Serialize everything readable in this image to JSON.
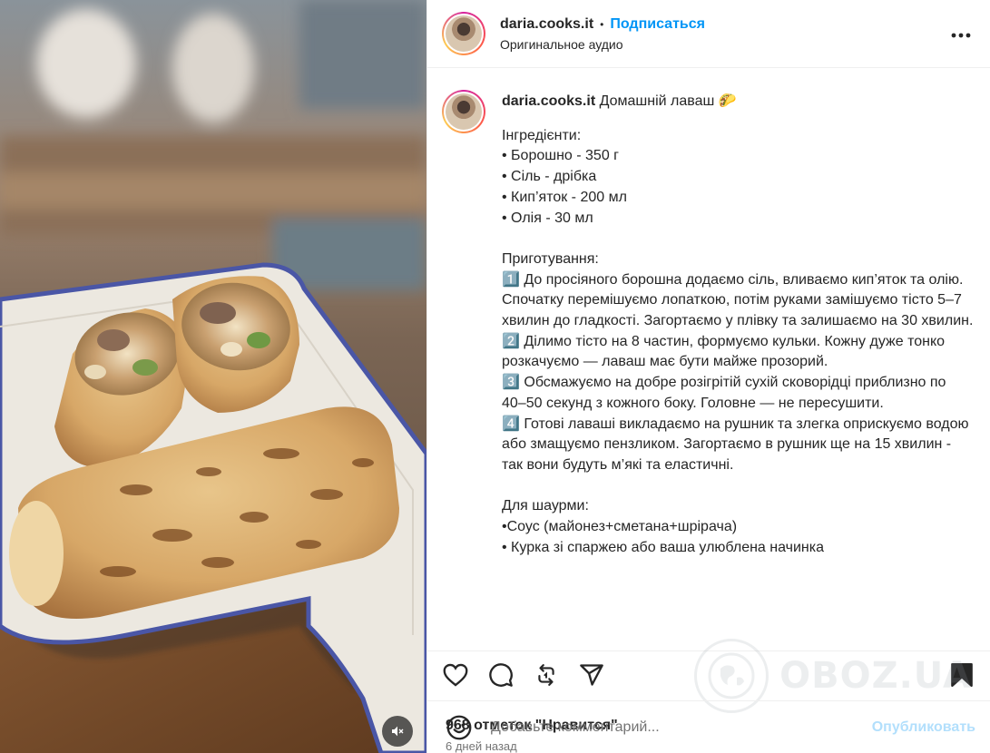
{
  "colors": {
    "accent": "#0095f6",
    "publish_disabled": "#b2dffc",
    "text": "#262626",
    "muted": "#737373"
  },
  "header": {
    "username": "daria.cooks.it",
    "separator": "•",
    "follow_label": "Подписаться",
    "audio_label": "Оригинальное аудио",
    "more_icon": "more-horizontal-icon"
  },
  "caption": {
    "username": "daria.cooks.it",
    "title": "Домашній лаваш 🌮",
    "text": "Інгредієнти:\n• Борошно - 350 г\n• Сіль - дрібка\n• Кип’яток - 200 мл\n• Олія - 30 мл\n\nПриготування:\n1️⃣ До просіяного борошна додаємо сіль, вливаємо кип’яток та олію. Спочатку перемішуємо лопаткою, потім руками замішуємо тісто 5–7 хвилин до гладкості. Загортаємо у плівку та залишаємо на 30 хвилин.\n2️⃣ Ділимо тісто на 8 частин, формуємо кульки. Кожну дуже тонко розкачуємо — лаваш має бути майже прозорий.\n3️⃣ Обсмажуємо на добре розігрітій сухій сковорідці приблизно по 40–50 секунд з кожного боку. Головне — не пересушити.\n4️⃣ Готові лаваші викладаємо на рушник та злегка оприскуємо водою або змащуємо пензликом. Загортаємо в рушник ще на 15 хвилин - так вони будуть м’які та еластичні.\n\nДля шаурми:\n•Соус (майонез+сметана+шрірача)\n• Курка зі спаржею або ваша улюблена начинка"
  },
  "actions": {
    "like_icon": "heart-icon",
    "comment_icon": "comment-icon",
    "repost_icon": "repost-icon",
    "share_icon": "share-icon",
    "save_icon": "bookmark-icon"
  },
  "likes_label": "968 отметок \"Нравится\"",
  "time_label": "6 дней назад",
  "comment": {
    "placeholder": "Добавьте комментарий...",
    "publish_label": "Опубликовать",
    "emoji_icon": "emoji-icon"
  },
  "media": {
    "mute_icon": "volume-muted-icon"
  },
  "watermark": {
    "text": "OBOZ.UA"
  }
}
